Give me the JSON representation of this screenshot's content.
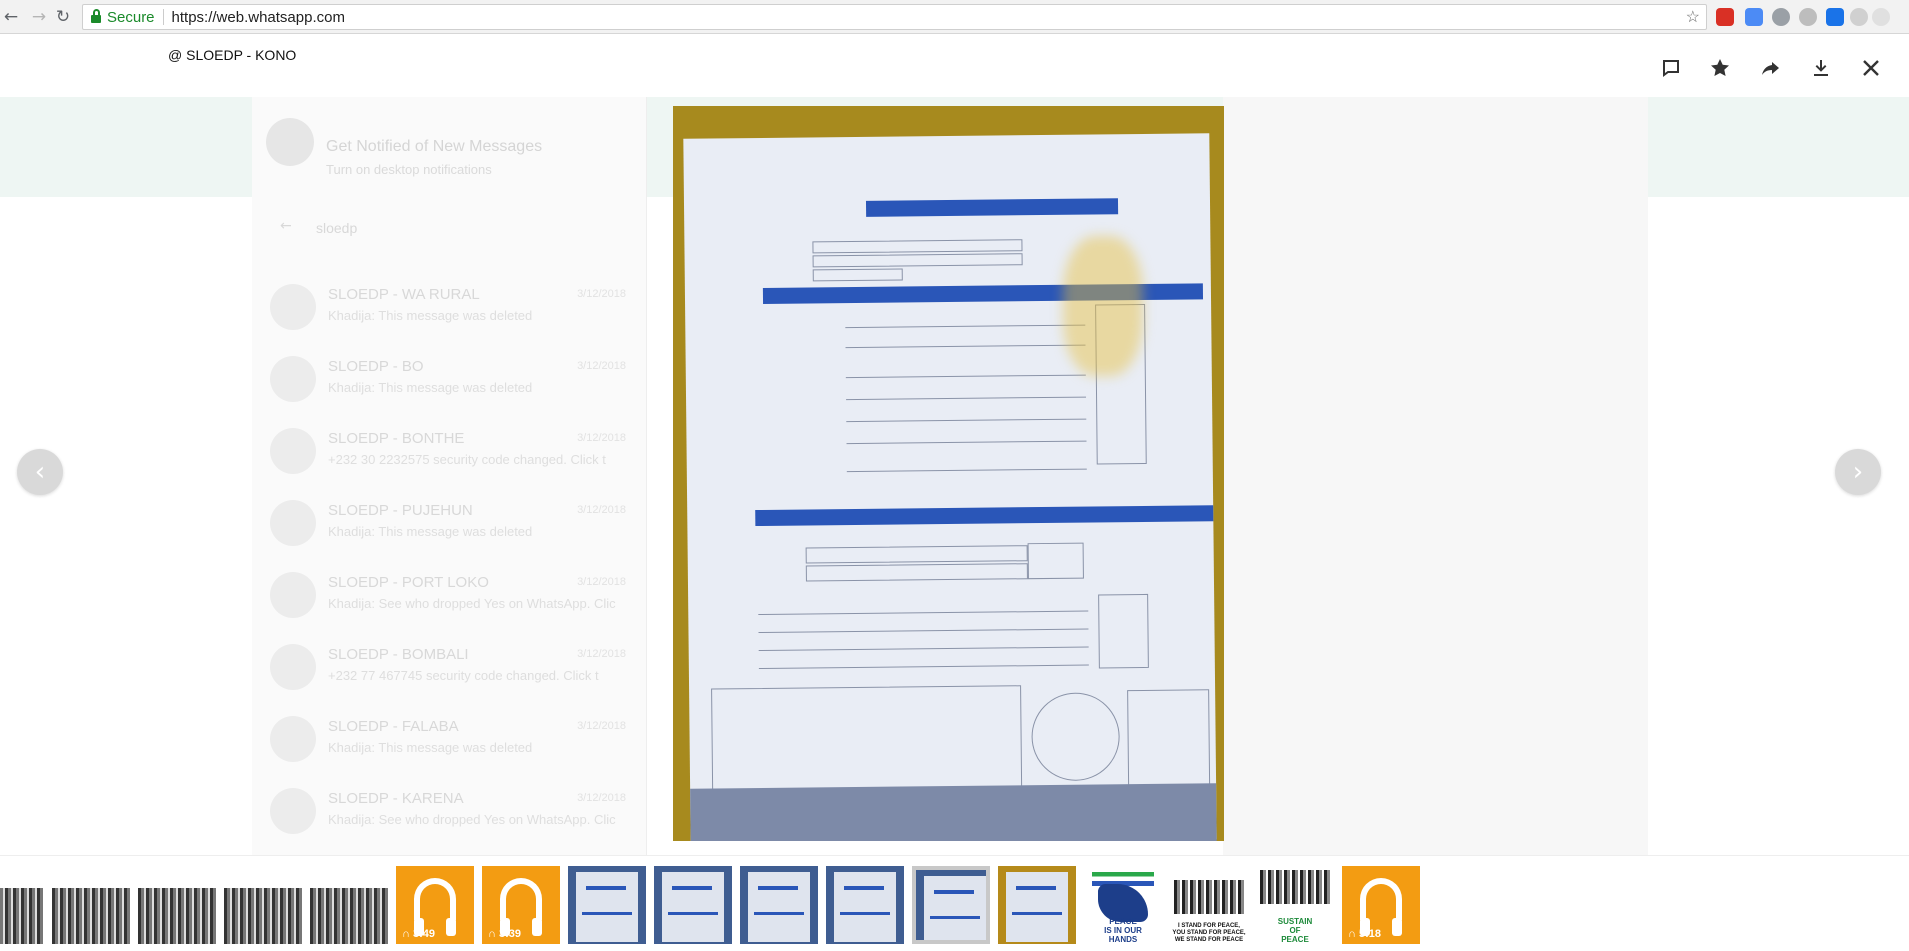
{
  "browser": {
    "secure_label": "Secure",
    "url": "https://web.whatsapp.com"
  },
  "viewer": {
    "chat_title": "@ SLOEDP - KONO",
    "toolbar_icons": [
      "message-icon",
      "star-icon",
      "forward-icon",
      "download-icon",
      "close-icon"
    ]
  },
  "background": {
    "notification_title": "Get Notified of New Messages",
    "notification_subtitle": "Turn on desktop notifications",
    "search_text": "sloedp",
    "chats": [
      {
        "name": "SLOEDP - WA RURAL",
        "message": "Khadija: This message was deleted",
        "time": "3/12/2018"
      },
      {
        "name": "SLOEDP - BO",
        "message": "Khadija: This message was deleted",
        "time": "3/12/2018"
      },
      {
        "name": "SLOEDP - BONTHE",
        "message": "+232 30 2232575 security code changed. Click t",
        "time": "3/12/2018"
      },
      {
        "name": "SLOEDP - PUJEHUN",
        "message": "Khadija: This message was deleted",
        "time": "3/12/2018"
      },
      {
        "name": "SLOEDP - PORT LOKO",
        "message": "Khadija: See who dropped Yes on WhatsApp. Clic",
        "time": "3/12/2018"
      },
      {
        "name": "SLOEDP - BOMBALI",
        "message": "+232 77 467745 security code changed. Click t",
        "time": "3/12/2018"
      },
      {
        "name": "SLOEDP - FALABA",
        "message": "Khadija: This message was deleted",
        "time": "3/12/2018"
      },
      {
        "name": "SLOEDP - KARENA",
        "message": "Khadija: See who dropped Yes on WhatsApp. Clic",
        "time": "3/12/2018"
      }
    ]
  },
  "thumbnails": [
    {
      "type": "people"
    },
    {
      "type": "people"
    },
    {
      "type": "people"
    },
    {
      "type": "people"
    },
    {
      "type": "people"
    },
    {
      "type": "audio",
      "duration": "3:49"
    },
    {
      "type": "audio",
      "duration": "3:39"
    },
    {
      "type": "doc"
    },
    {
      "type": "doc"
    },
    {
      "type": "doc"
    },
    {
      "type": "doc"
    },
    {
      "type": "doc",
      "selected": true
    },
    {
      "type": "doc"
    },
    {
      "type": "poster-map",
      "text": "PEACE\nIS IN OUR\nHANDS"
    },
    {
      "type": "poster-crowd",
      "text": "I STAND FOR PEACE,\nYOU STAND FOR PEACE,\nWE STAND FOR PEACE"
    },
    {
      "type": "poster-crowd",
      "text": "SUSTAIN\nOF\nPEACE"
    },
    {
      "type": "audio",
      "duration": "5:18"
    }
  ],
  "colors": {
    "audio_orange": "#f39c12",
    "secure_green": "#1a8a2a",
    "ballot_blue": "#2a56b8"
  }
}
